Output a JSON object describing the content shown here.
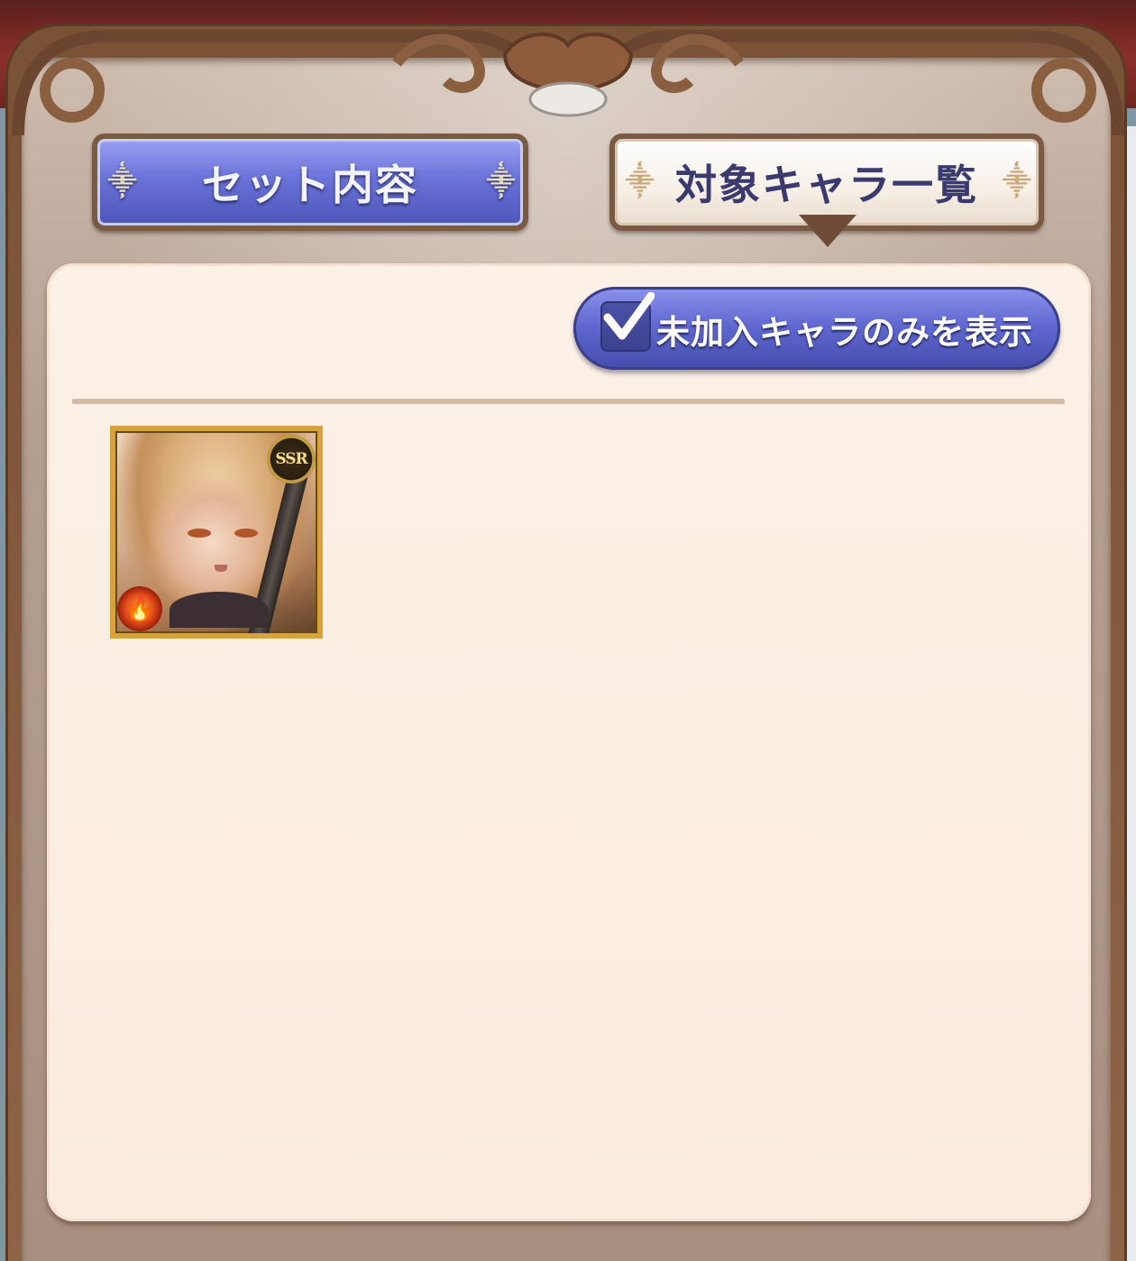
{
  "tabs": {
    "set_contents": "セット内容",
    "target_characters": "対象キャラ一覧",
    "active": "target_characters"
  },
  "filter": {
    "label": "未加入キャラのみを表示",
    "checked": true
  },
  "characters": [
    {
      "rarity": "SSR",
      "element": "fire",
      "element_icon": "fire-element-icon"
    }
  ],
  "colors": {
    "tab_active_blue": "#5d66cf",
    "frame_brown": "#7a5236",
    "panel_bg": "#fbf1e7",
    "tab_text_dark": "#3b3a6e"
  }
}
